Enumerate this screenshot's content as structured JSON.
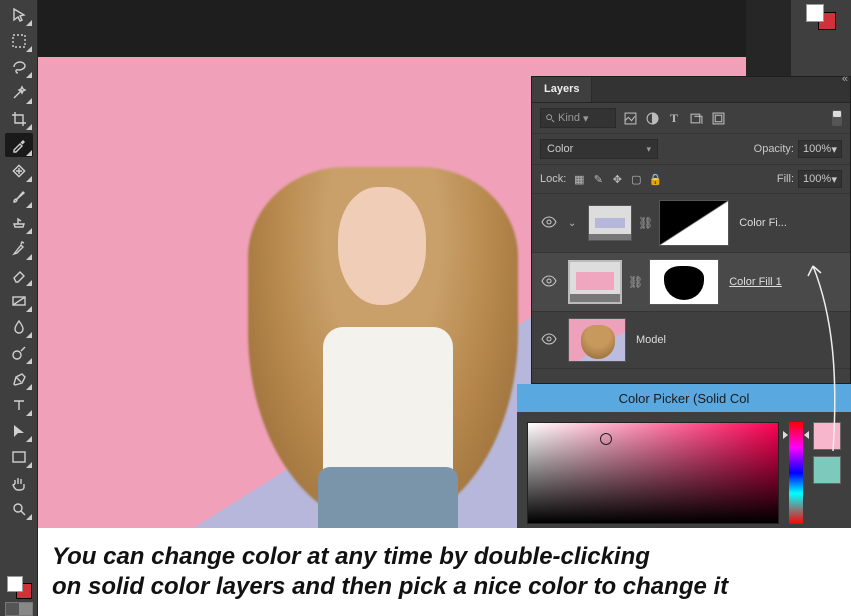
{
  "panel": {
    "tab": "Layers",
    "kind_placeholder": "Kind",
    "blend_mode": "Color",
    "opacity_label": "Opacity:",
    "opacity_value": "100%",
    "fill_label": "Fill:",
    "fill_value": "100%",
    "lock_label": "Lock:"
  },
  "layers": [
    {
      "name": "Color Fi...",
      "mask": "triangle",
      "fill_color": "#b7b7db",
      "selected": false
    },
    {
      "name": "Color Fill 1",
      "mask": "person",
      "fill_color": "#f0a6be",
      "selected": true,
      "underlined": true
    },
    {
      "name": "Model",
      "mask": null,
      "selected": false
    }
  ],
  "color_picker": {
    "title": "Color Picker (Solid Col",
    "swatch_a": "#f7b6cc",
    "swatch_b": "#7dc9bb"
  },
  "caption_line1": "You can change color at any time by double-clicking",
  "caption_line2": "on solid color layers and then pick a nice color to change it",
  "tools": [
    "move",
    "rect-marquee",
    "lasso",
    "magic-wand",
    "crop",
    "eyedropper",
    "ruler",
    "brush",
    "clone-stamp",
    "history-brush",
    "eraser",
    "gradient",
    "blur",
    "dodge",
    "pen",
    "type",
    "path-select",
    "rectangle",
    "hand",
    "zoom"
  ]
}
